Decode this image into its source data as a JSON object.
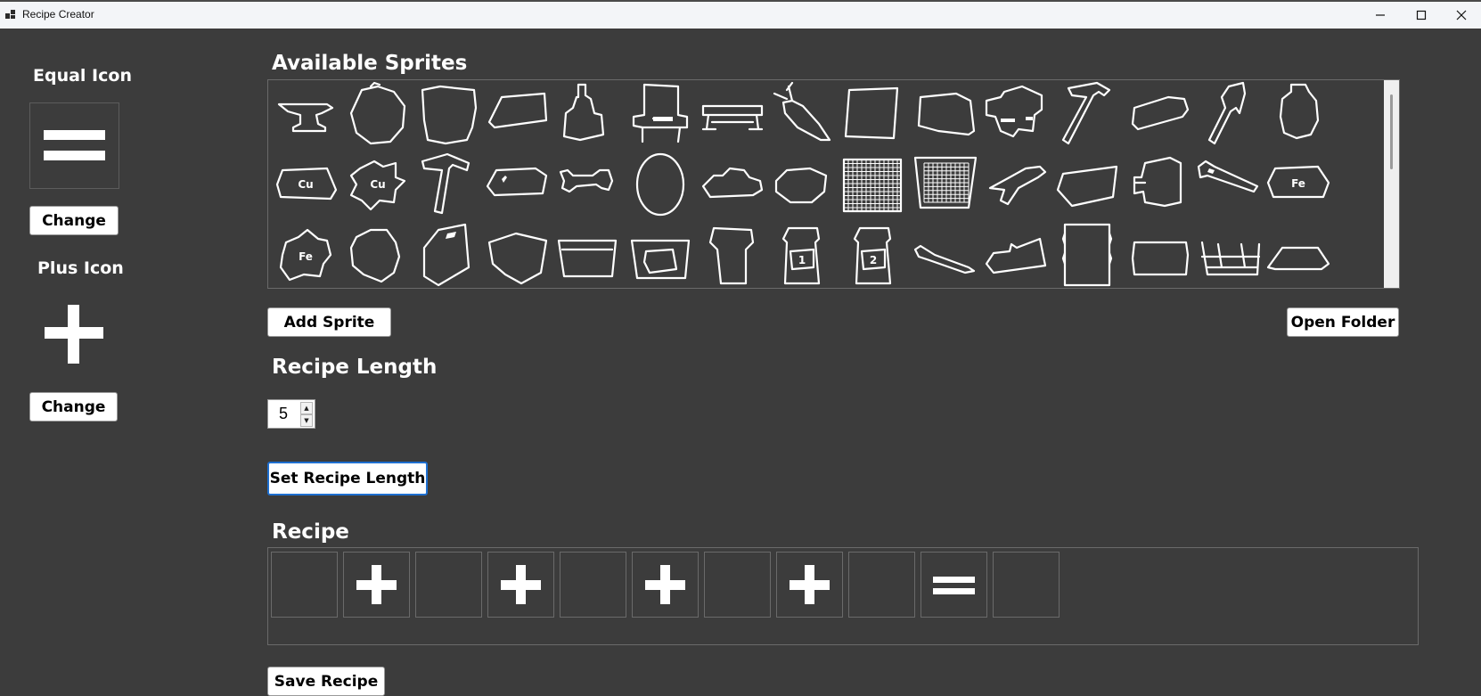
{
  "window": {
    "title": "Recipe Creator",
    "app_icon": "app-window-icon",
    "controls": [
      "minimize-icon",
      "maximize-icon",
      "close-icon"
    ]
  },
  "left_panel": {
    "equal_icon_title": "Equal Icon",
    "equal_change_label": "Change",
    "plus_icon_title": "Plus Icon",
    "plus_change_label": "Change"
  },
  "sprites": {
    "title": "Available Sprites",
    "items": [
      [
        "anvil-sprite",
        "rock-sprite",
        "stone-block-sprite",
        "plank-sprite",
        "bottle-sprite",
        "chair-sprite",
        "workbench-sprite",
        "carrot-sprite",
        "square-sprite",
        "slab-sprite",
        "furnace-sprite",
        "hammer-sprite",
        "wedge-sprite",
        "axe-sprite",
        "pot-sprite"
      ],
      [
        "copper-ingot-sprite",
        "copper-ore-sprite",
        "pickaxe-sprite",
        "glass-plate-sprite",
        "bone-sprite",
        "egg-sprite",
        "cloud-sprite",
        "round-stone-sprite",
        "mesh-sprite",
        "basket-sprite",
        "stick-sprite",
        "board-sprite",
        "machine-sprite",
        "saw-sprite",
        "iron-ingot-sprite"
      ],
      [
        "iron-ore-sprite",
        "ore-chunk-sprite",
        "shard-sprite",
        "shield-sprite",
        "bucket-sprite",
        "crucible-sprite",
        "vase-sprite",
        "potion-1-sprite",
        "potion-2-sprite",
        "knife-sprite",
        "glove-sprite",
        "pillar-sprite",
        "cushion-sprite",
        "bed-sprite",
        "tray-sprite"
      ]
    ],
    "labels": {
      "copper": "Cu",
      "iron": "Fe",
      "potion1": "1",
      "potion2": "2"
    },
    "add_label": "Add Sprite",
    "open_folder_label": "Open Folder"
  },
  "recipe_length": {
    "title": "Recipe Length",
    "value": "5",
    "set_label": "Set Recipe Length"
  },
  "recipe": {
    "title": "Recipe",
    "slots": [
      "empty",
      "plus",
      "empty",
      "plus",
      "empty",
      "plus",
      "empty",
      "plus",
      "empty",
      "equal",
      "empty"
    ],
    "save_label": "Save Recipe"
  },
  "colors": {
    "background": "#3c3c3c",
    "titlebar": "#f3f5f8",
    "focus_border": "#1e6fd0",
    "sprite_stroke": "#ffffff"
  }
}
